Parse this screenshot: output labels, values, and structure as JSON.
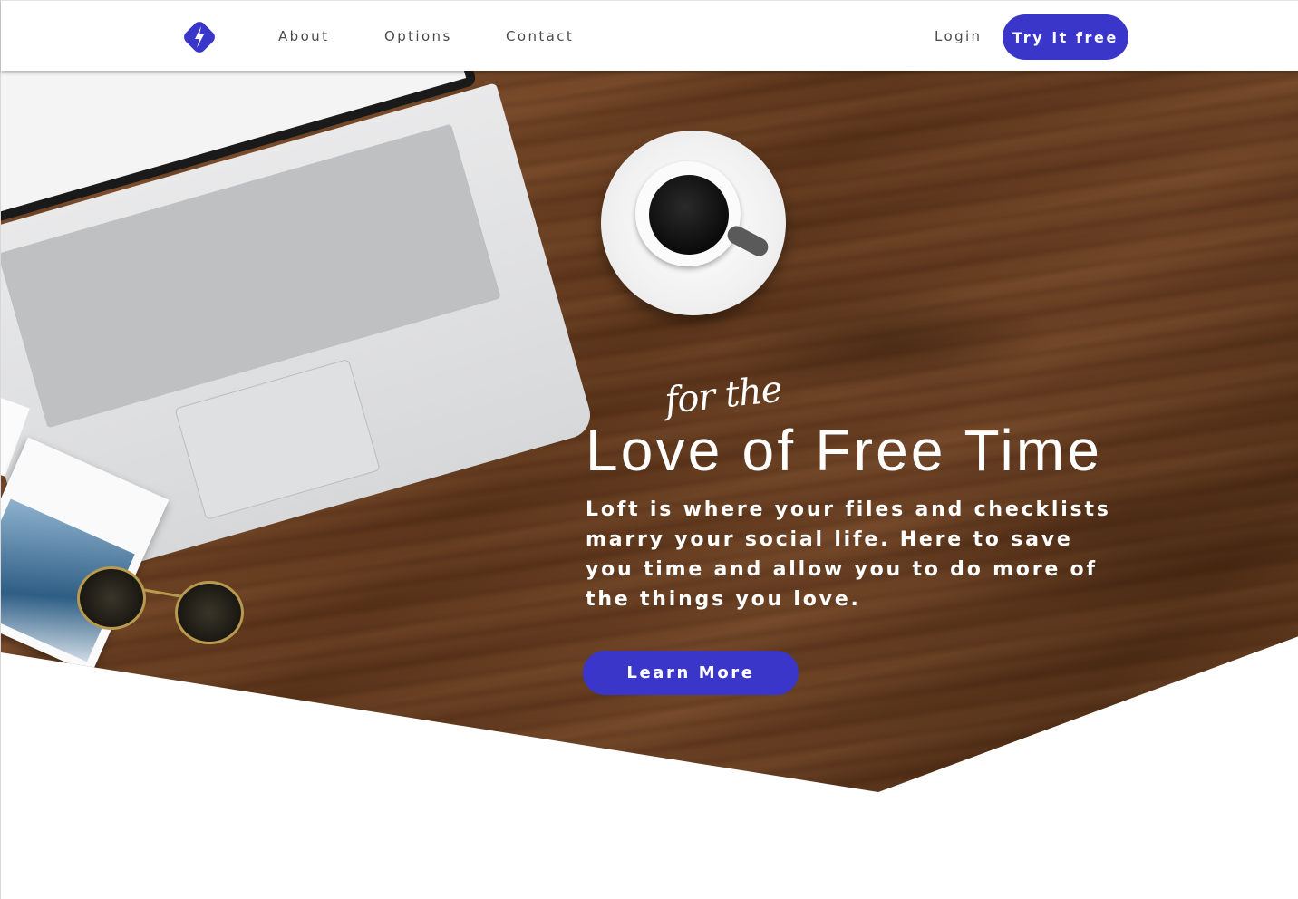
{
  "header": {
    "nav": {
      "about": "About",
      "options": "Options",
      "contact": "Contact",
      "login": "Login"
    },
    "cta_label": "Try it free",
    "logo_icon": "bolt-diamond-logo"
  },
  "hero": {
    "script_text": "for the",
    "title": "Love of Free Time",
    "description": "Loft is where your files and checklists marry your social life. Here to save you time and allow you to do more of the things you love.",
    "button_label": "Learn More"
  },
  "colors": {
    "accent": "#3a36c9",
    "header_bg": "#ffffff",
    "nav_text": "#4a4a4a"
  }
}
